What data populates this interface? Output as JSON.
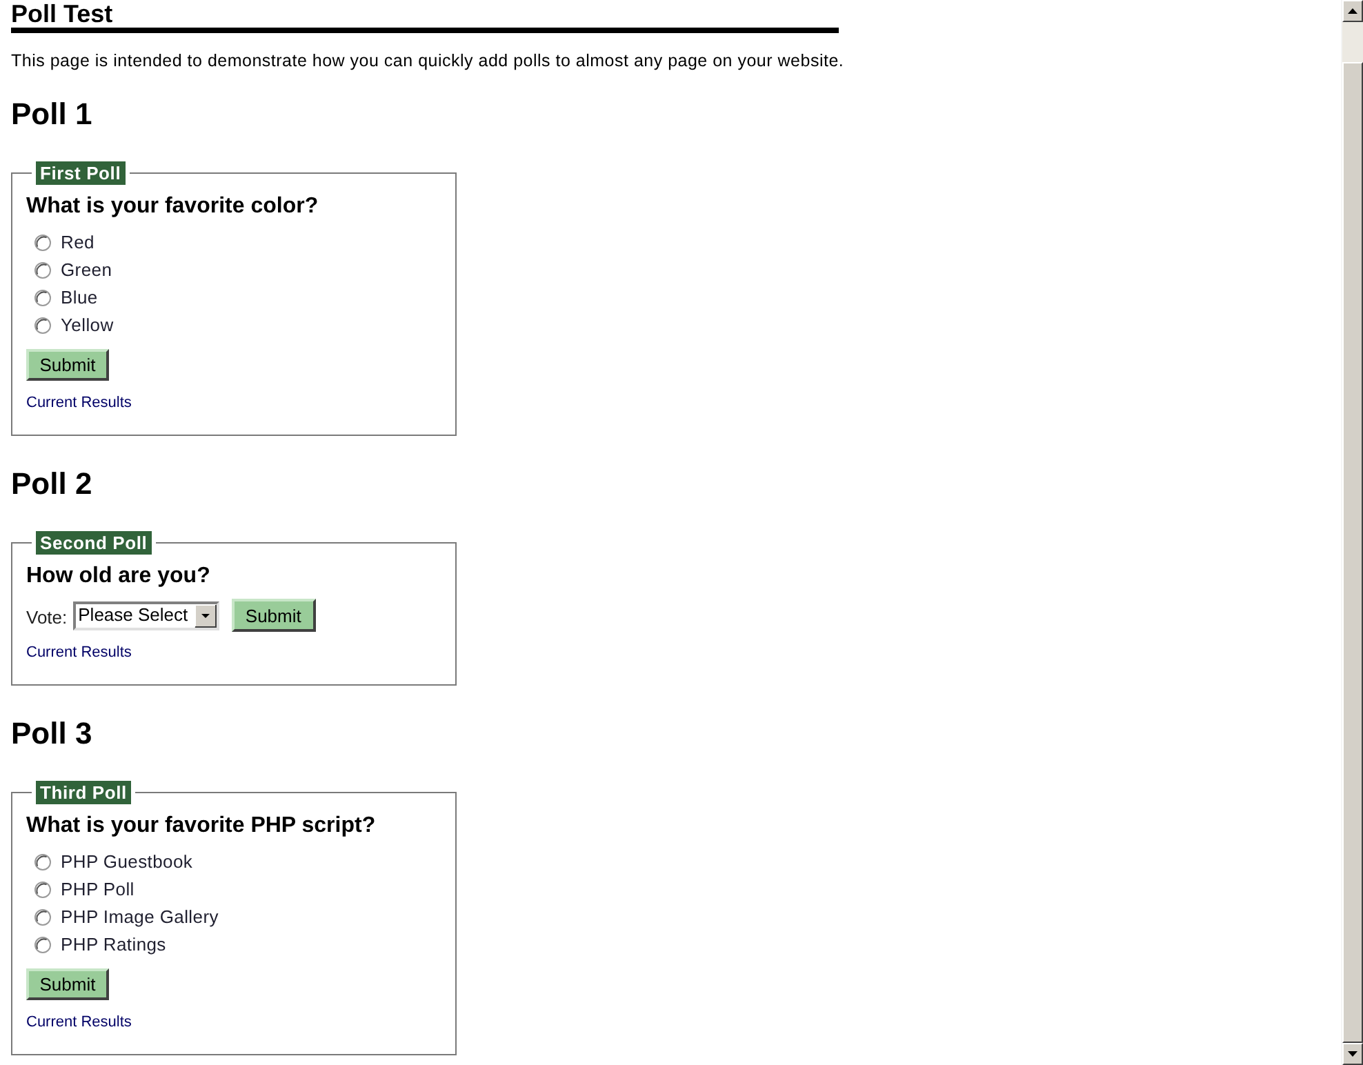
{
  "page": {
    "title": "Poll Test",
    "intro": "This page is intended to demonstrate how you can quickly add polls to almost any page on your website."
  },
  "polls": [
    {
      "heading": "Poll 1",
      "legend": "First Poll",
      "question": "What is your favorite color?",
      "kind": "radio",
      "options": [
        {
          "label": "Red",
          "selected": false
        },
        {
          "label": "Green",
          "selected": false
        },
        {
          "label": "Blue",
          "selected": false
        },
        {
          "label": "Yellow",
          "selected": false
        }
      ],
      "submit": "Submit",
      "results_link": "Current Results"
    },
    {
      "heading": "Poll 2",
      "legend": "Second Poll",
      "question": "How old are you?",
      "kind": "dropdown",
      "field_label": "Vote:",
      "select_value": "Please Select",
      "submit": "Submit",
      "results_link": "Current Results"
    },
    {
      "heading": "Poll 3",
      "legend": "Third Poll",
      "question": "What is your favorite PHP script?",
      "kind": "radio",
      "options": [
        {
          "label": "PHP Guestbook",
          "selected": false
        },
        {
          "label": "PHP Poll",
          "selected": false
        },
        {
          "label": "PHP Image Gallery",
          "selected": false
        },
        {
          "label": "PHP Ratings",
          "selected": false
        }
      ],
      "submit": "Submit",
      "results_link": "Current Results"
    }
  ]
}
